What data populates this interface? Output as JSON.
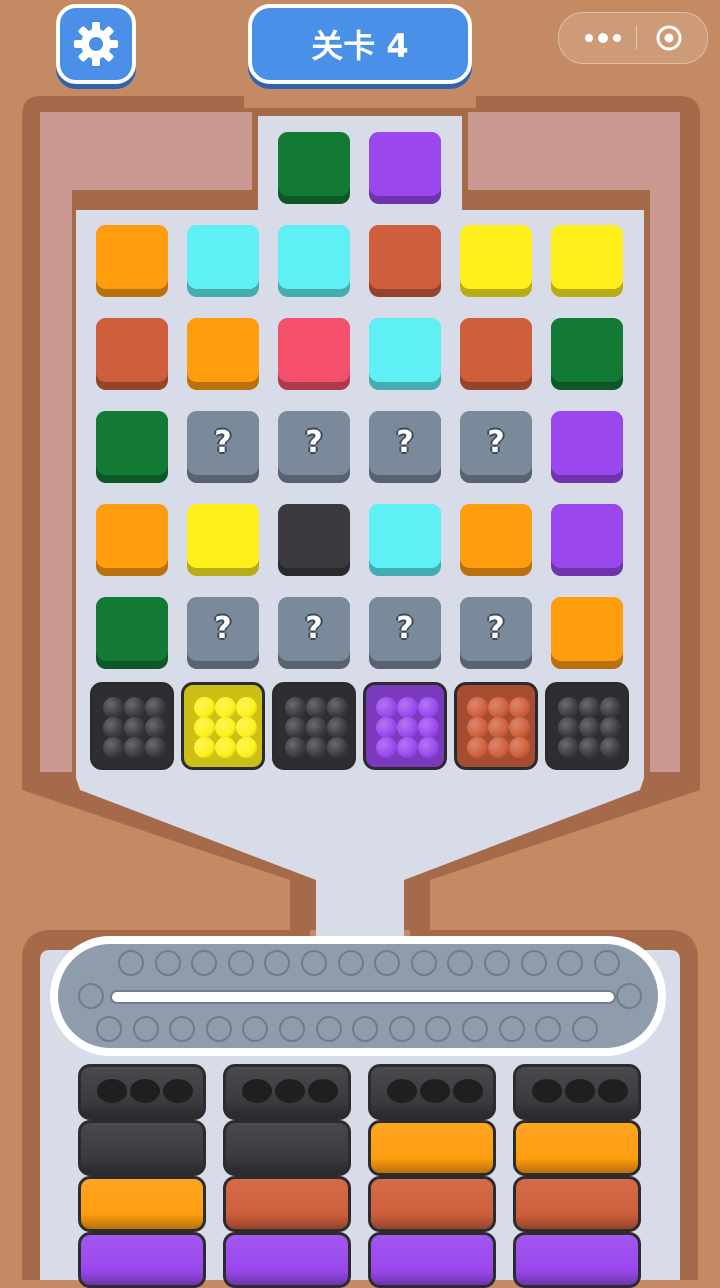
{
  "header": {
    "level_label": "关卡 4",
    "settings_icon": "gear-icon",
    "menu_icons": [
      "more-icon",
      "close-icon"
    ]
  },
  "colors": {
    "orange": "#ff9d0f",
    "cyan": "#5ff0f5",
    "brown": "#cf5f3c",
    "yellow": "#fff01c",
    "pink": "#f4506b",
    "green": "#137a36",
    "purple": "#9a48ee",
    "black": "#3a3a3f",
    "hidden": "#7a8a9a"
  },
  "board": {
    "top_pocket": [
      "green",
      "purple"
    ],
    "rows": [
      [
        "orange",
        "cyan",
        "cyan",
        "brown",
        "yellow",
        "yellow"
      ],
      [
        "brown",
        "orange",
        "pink",
        "cyan",
        "brown",
        "green"
      ],
      [
        "green",
        "hidden",
        "hidden",
        "hidden",
        "hidden",
        "purple"
      ],
      [
        "orange",
        "yellow",
        "black",
        "cyan",
        "orange",
        "purple"
      ],
      [
        "green",
        "hidden",
        "hidden",
        "hidden",
        "hidden",
        "orange"
      ]
    ],
    "hidden_symbol": "?",
    "ball_boxes": [
      "black",
      "yellow",
      "black",
      "purple",
      "brown",
      "black"
    ]
  },
  "conveyor": {
    "top_slots": 14,
    "bottom_slots": 14
  },
  "trays": {
    "columns": [
      [
        "black",
        "black",
        "orange",
        "purple"
      ],
      [
        "black",
        "black",
        "brown",
        "purple"
      ],
      [
        "black",
        "orange",
        "brown",
        "purple"
      ],
      [
        "black",
        "orange",
        "brown",
        "purple"
      ]
    ]
  }
}
